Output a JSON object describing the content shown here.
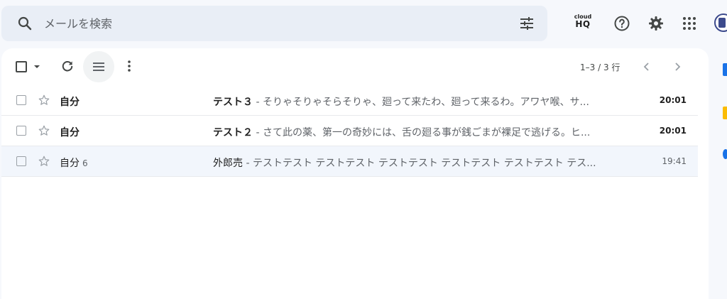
{
  "search": {
    "placeholder": "メールを検索"
  },
  "header": {
    "cloudhq_top": "cloud",
    "cloudhq_bottom": "HQ"
  },
  "toolbar": {
    "pager": "1–3 / 3 行"
  },
  "colors": {
    "accent": "#0b57d0",
    "unread_bg": "#ffffff",
    "read_bg": "#f2f6fc",
    "side_blue": "#1a73e8",
    "side_yellow": "#fbbc04"
  },
  "emails": [
    {
      "sender": "自分",
      "count": "",
      "subject": "テスト３",
      "snippet": " - そりゃそりゃそらそりゃ、廻って来たわ、廻って来るわ。アワヤ喉、サ...",
      "time": "20:01",
      "unread": true
    },
    {
      "sender": "自分",
      "count": "",
      "subject": "テスト２",
      "snippet": " - さて此の薬、第一の奇妙には、舌の廻る事が銭ごまが裸足で逃げる。ヒ...",
      "time": "20:01",
      "unread": true
    },
    {
      "sender": "自分",
      "count": "6",
      "subject": "外郎売",
      "snippet": " - テストテスト テストテスト テストテスト テストテスト テストテスト テス...",
      "time": "19:41",
      "unread": false
    }
  ]
}
